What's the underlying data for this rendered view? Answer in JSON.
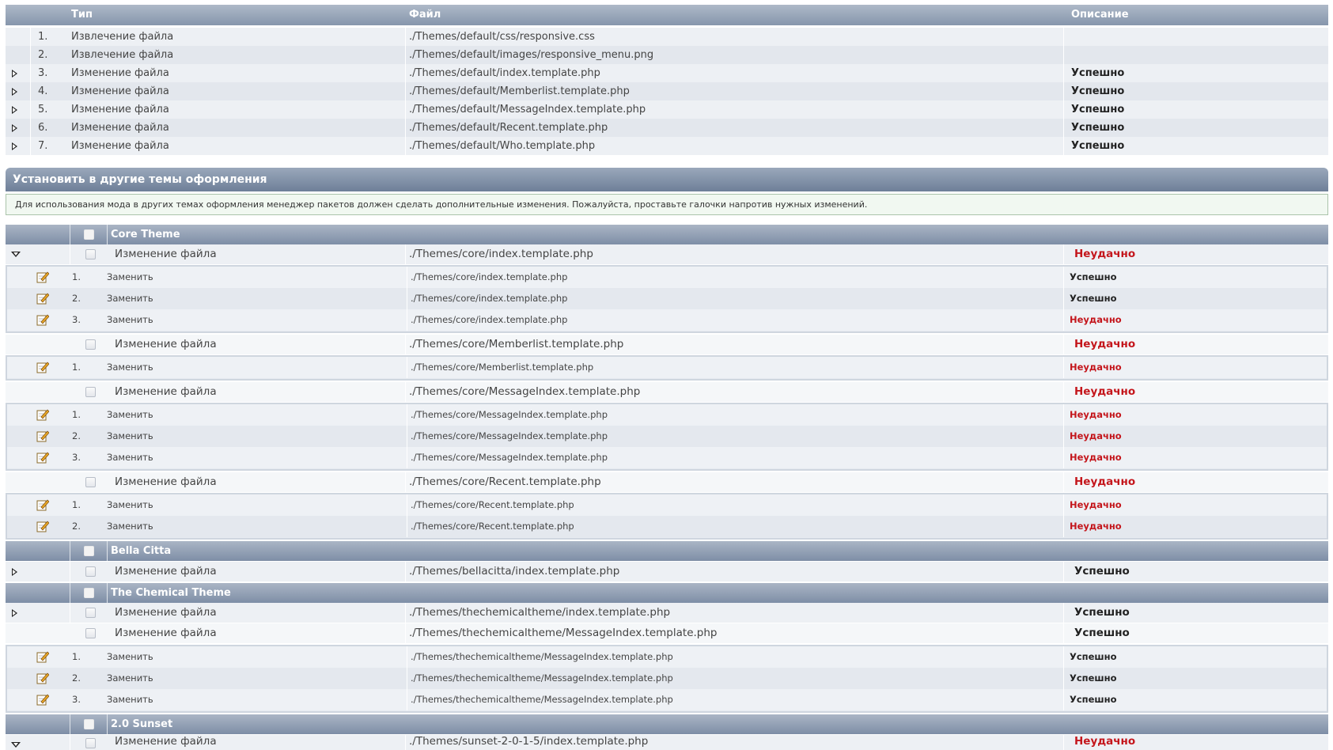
{
  "top_table": {
    "headers": {
      "type": "Тип",
      "file": "Файл",
      "desc": "Описание"
    },
    "rows": [
      {
        "num": "1.",
        "type": "Извлечение файла",
        "file": "./Themes/default/css/responsive.css",
        "status": "",
        "expand": false
      },
      {
        "num": "2.",
        "type": "Извлечение файла",
        "file": "./Themes/default/images/responsive_menu.png",
        "status": "",
        "expand": false
      },
      {
        "num": "3.",
        "type": "Изменение файла",
        "file": "./Themes/default/index.template.php",
        "status": "Успешно",
        "expand": true
      },
      {
        "num": "4.",
        "type": "Изменение файла",
        "file": "./Themes/default/Memberlist.template.php",
        "status": "Успешно",
        "expand": true
      },
      {
        "num": "5.",
        "type": "Изменение файла",
        "file": "./Themes/default/MessageIndex.template.php",
        "status": "Успешно",
        "expand": true
      },
      {
        "num": "6.",
        "type": "Изменение файла",
        "file": "./Themes/default/Recent.template.php",
        "status": "Успешно",
        "expand": true
      },
      {
        "num": "7.",
        "type": "Изменение файла",
        "file": "./Themes/default/Who.template.php",
        "status": "Успешно",
        "expand": true
      }
    ]
  },
  "section": {
    "title": "Установить в другие темы оформления",
    "info": "Для использования мода в других темах оформления менеджер пакетов должен сделать дополнительные изменения. Пожалуйста, проставьте галочки напротив нужных изменений."
  },
  "themes": {
    "core": {
      "name": "Core Theme",
      "files": [
        {
          "type": "Изменение файла",
          "file": "./Themes/core/index.template.php",
          "status": "Неудачно",
          "subs": [
            {
              "num": "1.",
              "type": "Заменить",
              "file": "./Themes/core/index.template.php",
              "status": "Успешно"
            },
            {
              "num": "2.",
              "type": "Заменить",
              "file": "./Themes/core/index.template.php",
              "status": "Успешно"
            },
            {
              "num": "3.",
              "type": "Заменить",
              "file": "./Themes/core/index.template.php",
              "status": "Неудачно"
            }
          ]
        },
        {
          "type": "Изменение файла",
          "file": "./Themes/core/Memberlist.template.php",
          "status": "Неудачно",
          "subs": [
            {
              "num": "1.",
              "type": "Заменить",
              "file": "./Themes/core/Memberlist.template.php",
              "status": "Неудачно"
            }
          ]
        },
        {
          "type": "Изменение файла",
          "file": "./Themes/core/MessageIndex.template.php",
          "status": "Неудачно",
          "subs": [
            {
              "num": "1.",
              "type": "Заменить",
              "file": "./Themes/core/MessageIndex.template.php",
              "status": "Неудачно"
            },
            {
              "num": "2.",
              "type": "Заменить",
              "file": "./Themes/core/MessageIndex.template.php",
              "status": "Неудачно"
            },
            {
              "num": "3.",
              "type": "Заменить",
              "file": "./Themes/core/MessageIndex.template.php",
              "status": "Неудачно"
            }
          ]
        },
        {
          "type": "Изменение файла",
          "file": "./Themes/core/Recent.template.php",
          "status": "Неудачно",
          "subs": [
            {
              "num": "1.",
              "type": "Заменить",
              "file": "./Themes/core/Recent.template.php",
              "status": "Неудачно"
            },
            {
              "num": "2.",
              "type": "Заменить",
              "file": "./Themes/core/Recent.template.php",
              "status": "Неудачно"
            }
          ]
        }
      ]
    },
    "bella": {
      "name": "Bella Citta",
      "files": [
        {
          "type": "Изменение файла",
          "file": "./Themes/bellacitta/index.template.php",
          "status": "Успешно"
        }
      ]
    },
    "chemical": {
      "name": "The Chemical Theme",
      "files": [
        {
          "type": "Изменение файла",
          "file": "./Themes/thechemicaltheme/index.template.php",
          "status": "Успешно"
        },
        {
          "type": "Изменение файла",
          "file": "./Themes/thechemicaltheme/MessageIndex.template.php",
          "status": "Успешно",
          "subs": [
            {
              "num": "1.",
              "type": "Заменить",
              "file": "./Themes/thechemicaltheme/MessageIndex.template.php",
              "status": "Успешно"
            },
            {
              "num": "2.",
              "type": "Заменить",
              "file": "./Themes/thechemicaltheme/MessageIndex.template.php",
              "status": "Успешно"
            },
            {
              "num": "3.",
              "type": "Заменить",
              "file": "./Themes/thechemicaltheme/MessageIndex.template.php",
              "status": "Успешно"
            }
          ]
        }
      ]
    },
    "sunset": {
      "name": "2.0 Sunset",
      "files": [
        {
          "type": "Изменение файла",
          "file": "./Themes/sunset-2-0-1-5/index.template.php",
          "status": "Неудачно"
        }
      ]
    }
  },
  "colors": {
    "fail": "#c4161c",
    "header": "#8696ac"
  }
}
